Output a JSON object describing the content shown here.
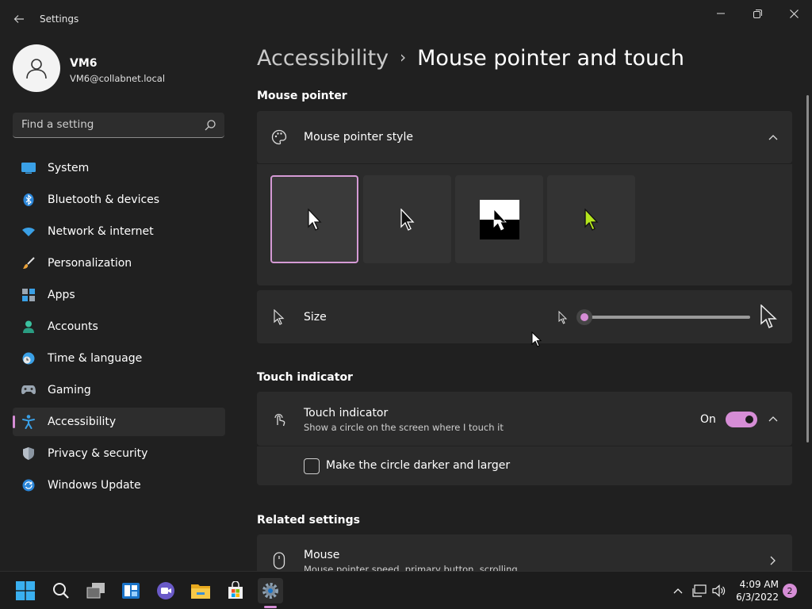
{
  "window": {
    "app_title": "Settings",
    "back_icon": "back-arrow-icon",
    "controls": [
      "minimize-icon",
      "restore-icon",
      "close-icon"
    ]
  },
  "profile": {
    "name": "VM6",
    "email": "VM6@collabnet.local"
  },
  "search": {
    "placeholder": "Find a setting"
  },
  "sidebar": {
    "items": [
      {
        "label": "System",
        "icon": "monitor-icon"
      },
      {
        "label": "Bluetooth & devices",
        "icon": "bluetooth-icon"
      },
      {
        "label": "Network & internet",
        "icon": "wifi-icon"
      },
      {
        "label": "Personalization",
        "icon": "brush-icon"
      },
      {
        "label": "Apps",
        "icon": "apps-icon"
      },
      {
        "label": "Accounts",
        "icon": "person-icon"
      },
      {
        "label": "Time & language",
        "icon": "globe-clock-icon"
      },
      {
        "label": "Gaming",
        "icon": "gamepad-icon"
      },
      {
        "label": "Accessibility",
        "icon": "accessibility-icon",
        "active": true
      },
      {
        "label": "Privacy & security",
        "icon": "shield-icon"
      },
      {
        "label": "Windows Update",
        "icon": "update-icon"
      }
    ]
  },
  "header": {
    "parent": "Accessibility",
    "current": "Mouse pointer and touch"
  },
  "mouse_pointer": {
    "section_title": "Mouse pointer",
    "style_card": {
      "label": "Mouse pointer style",
      "styles": [
        "white",
        "black",
        "inverted",
        "custom"
      ],
      "selected": "white",
      "custom_color": "#b5e61d"
    },
    "size_card": {
      "label": "Size",
      "level": 0.0
    }
  },
  "touch_indicator": {
    "section_title": "Touch indicator",
    "card": {
      "label": "Touch indicator",
      "description": "Show a circle on the screen where I touch it",
      "toggle_state": "On"
    },
    "option": {
      "label": "Make the circle darker and larger",
      "checked": false
    }
  },
  "related": {
    "section_title": "Related settings",
    "mouse": {
      "label": "Mouse",
      "description": "Mouse pointer speed, primary button, scrolling"
    }
  },
  "taskbar": {
    "apps": [
      "start-icon",
      "search-icon",
      "task-view-icon",
      "widgets-icon",
      "teams-chat-icon",
      "file-explorer-icon",
      "store-icon",
      "settings-icon"
    ],
    "time": "4:09 AM",
    "date": "6/3/2022",
    "notifications": "2"
  },
  "colors": {
    "accent": "#d68dd6",
    "background": "#202020",
    "card": "#2b2b2b"
  }
}
